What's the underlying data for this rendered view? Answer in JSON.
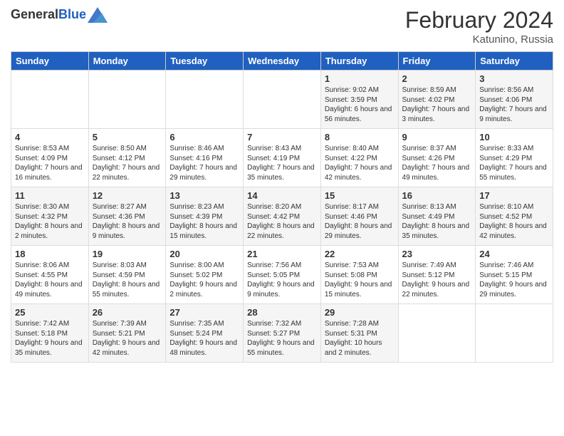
{
  "header": {
    "logo_general": "General",
    "logo_blue": "Blue",
    "month_title": "February 2024",
    "location": "Katunino, Russia"
  },
  "weekdays": [
    "Sunday",
    "Monday",
    "Tuesday",
    "Wednesday",
    "Thursday",
    "Friday",
    "Saturday"
  ],
  "weeks": [
    [
      {
        "day": "",
        "sunrise": "",
        "sunset": "",
        "daylight": ""
      },
      {
        "day": "",
        "sunrise": "",
        "sunset": "",
        "daylight": ""
      },
      {
        "day": "",
        "sunrise": "",
        "sunset": "",
        "daylight": ""
      },
      {
        "day": "",
        "sunrise": "",
        "sunset": "",
        "daylight": ""
      },
      {
        "day": "1",
        "sunrise": "Sunrise: 9:02 AM",
        "sunset": "Sunset: 3:59 PM",
        "daylight": "Daylight: 6 hours and 56 minutes."
      },
      {
        "day": "2",
        "sunrise": "Sunrise: 8:59 AM",
        "sunset": "Sunset: 4:02 PM",
        "daylight": "Daylight: 7 hours and 3 minutes."
      },
      {
        "day": "3",
        "sunrise": "Sunrise: 8:56 AM",
        "sunset": "Sunset: 4:06 PM",
        "daylight": "Daylight: 7 hours and 9 minutes."
      }
    ],
    [
      {
        "day": "4",
        "sunrise": "Sunrise: 8:53 AM",
        "sunset": "Sunset: 4:09 PM",
        "daylight": "Daylight: 7 hours and 16 minutes."
      },
      {
        "day": "5",
        "sunrise": "Sunrise: 8:50 AM",
        "sunset": "Sunset: 4:12 PM",
        "daylight": "Daylight: 7 hours and 22 minutes."
      },
      {
        "day": "6",
        "sunrise": "Sunrise: 8:46 AM",
        "sunset": "Sunset: 4:16 PM",
        "daylight": "Daylight: 7 hours and 29 minutes."
      },
      {
        "day": "7",
        "sunrise": "Sunrise: 8:43 AM",
        "sunset": "Sunset: 4:19 PM",
        "daylight": "Daylight: 7 hours and 35 minutes."
      },
      {
        "day": "8",
        "sunrise": "Sunrise: 8:40 AM",
        "sunset": "Sunset: 4:22 PM",
        "daylight": "Daylight: 7 hours and 42 minutes."
      },
      {
        "day": "9",
        "sunrise": "Sunrise: 8:37 AM",
        "sunset": "Sunset: 4:26 PM",
        "daylight": "Daylight: 7 hours and 49 minutes."
      },
      {
        "day": "10",
        "sunrise": "Sunrise: 8:33 AM",
        "sunset": "Sunset: 4:29 PM",
        "daylight": "Daylight: 7 hours and 55 minutes."
      }
    ],
    [
      {
        "day": "11",
        "sunrise": "Sunrise: 8:30 AM",
        "sunset": "Sunset: 4:32 PM",
        "daylight": "Daylight: 8 hours and 2 minutes."
      },
      {
        "day": "12",
        "sunrise": "Sunrise: 8:27 AM",
        "sunset": "Sunset: 4:36 PM",
        "daylight": "Daylight: 8 hours and 9 minutes."
      },
      {
        "day": "13",
        "sunrise": "Sunrise: 8:23 AM",
        "sunset": "Sunset: 4:39 PM",
        "daylight": "Daylight: 8 hours and 15 minutes."
      },
      {
        "day": "14",
        "sunrise": "Sunrise: 8:20 AM",
        "sunset": "Sunset: 4:42 PM",
        "daylight": "Daylight: 8 hours and 22 minutes."
      },
      {
        "day": "15",
        "sunrise": "Sunrise: 8:17 AM",
        "sunset": "Sunset: 4:46 PM",
        "daylight": "Daylight: 8 hours and 29 minutes."
      },
      {
        "day": "16",
        "sunrise": "Sunrise: 8:13 AM",
        "sunset": "Sunset: 4:49 PM",
        "daylight": "Daylight: 8 hours and 35 minutes."
      },
      {
        "day": "17",
        "sunrise": "Sunrise: 8:10 AM",
        "sunset": "Sunset: 4:52 PM",
        "daylight": "Daylight: 8 hours and 42 minutes."
      }
    ],
    [
      {
        "day": "18",
        "sunrise": "Sunrise: 8:06 AM",
        "sunset": "Sunset: 4:55 PM",
        "daylight": "Daylight: 8 hours and 49 minutes."
      },
      {
        "day": "19",
        "sunrise": "Sunrise: 8:03 AM",
        "sunset": "Sunset: 4:59 PM",
        "daylight": "Daylight: 8 hours and 55 minutes."
      },
      {
        "day": "20",
        "sunrise": "Sunrise: 8:00 AM",
        "sunset": "Sunset: 5:02 PM",
        "daylight": "Daylight: 9 hours and 2 minutes."
      },
      {
        "day": "21",
        "sunrise": "Sunrise: 7:56 AM",
        "sunset": "Sunset: 5:05 PM",
        "daylight": "Daylight: 9 hours and 9 minutes."
      },
      {
        "day": "22",
        "sunrise": "Sunrise: 7:53 AM",
        "sunset": "Sunset: 5:08 PM",
        "daylight": "Daylight: 9 hours and 15 minutes."
      },
      {
        "day": "23",
        "sunrise": "Sunrise: 7:49 AM",
        "sunset": "Sunset: 5:12 PM",
        "daylight": "Daylight: 9 hours and 22 minutes."
      },
      {
        "day": "24",
        "sunrise": "Sunrise: 7:46 AM",
        "sunset": "Sunset: 5:15 PM",
        "daylight": "Daylight: 9 hours and 29 minutes."
      }
    ],
    [
      {
        "day": "25",
        "sunrise": "Sunrise: 7:42 AM",
        "sunset": "Sunset: 5:18 PM",
        "daylight": "Daylight: 9 hours and 35 minutes."
      },
      {
        "day": "26",
        "sunrise": "Sunrise: 7:39 AM",
        "sunset": "Sunset: 5:21 PM",
        "daylight": "Daylight: 9 hours and 42 minutes."
      },
      {
        "day": "27",
        "sunrise": "Sunrise: 7:35 AM",
        "sunset": "Sunset: 5:24 PM",
        "daylight": "Daylight: 9 hours and 48 minutes."
      },
      {
        "day": "28",
        "sunrise": "Sunrise: 7:32 AM",
        "sunset": "Sunset: 5:27 PM",
        "daylight": "Daylight: 9 hours and 55 minutes."
      },
      {
        "day": "29",
        "sunrise": "Sunrise: 7:28 AM",
        "sunset": "Sunset: 5:31 PM",
        "daylight": "Daylight: 10 hours and 2 minutes."
      },
      {
        "day": "",
        "sunrise": "",
        "sunset": "",
        "daylight": ""
      },
      {
        "day": "",
        "sunrise": "",
        "sunset": "",
        "daylight": ""
      }
    ]
  ]
}
